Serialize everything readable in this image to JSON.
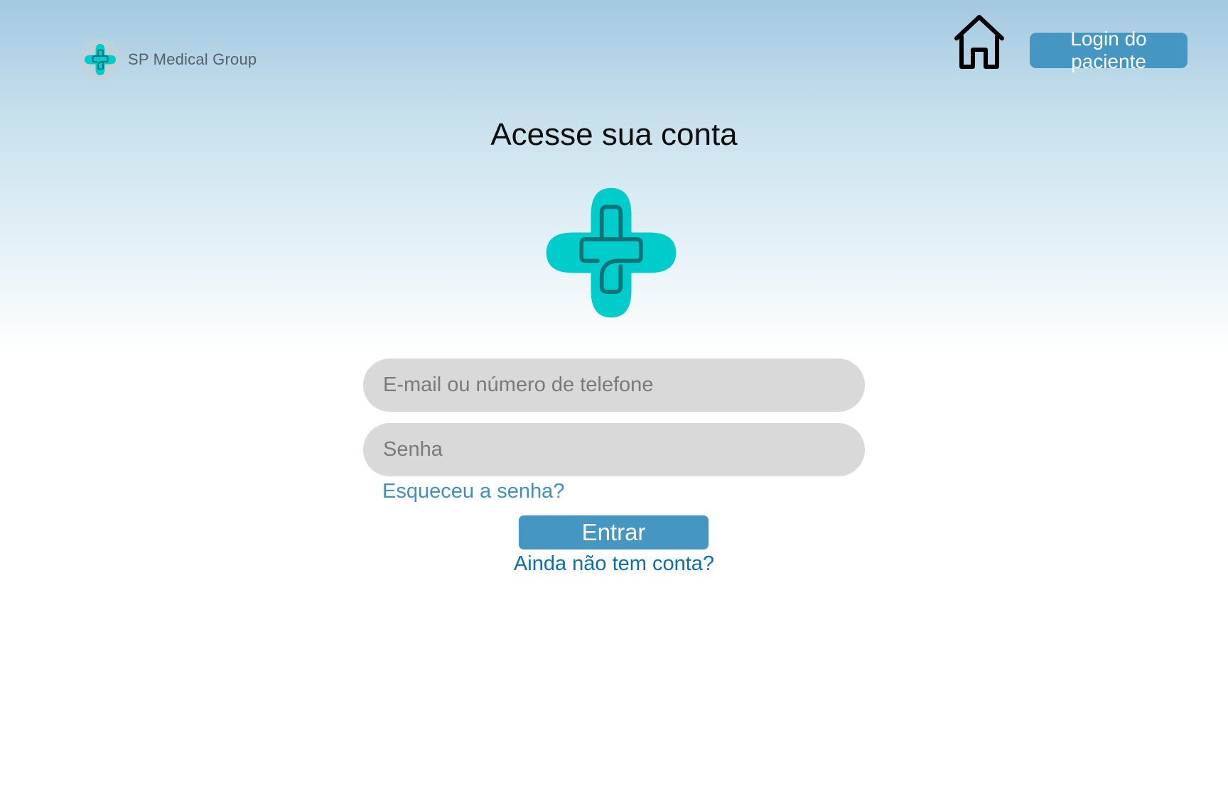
{
  "brand": {
    "name": "SP Medical Group",
    "logo_icon": "medical-cross-icon",
    "logo_color": "#00cccc",
    "logo_stroke_color": "#0f7378"
  },
  "nav": {
    "home_icon": "home-icon",
    "patient_login_label": "Login do paciente"
  },
  "login": {
    "title": "Acesse sua conta",
    "email_placeholder": "E-mail ou número de telefone",
    "email_value": "",
    "password_placeholder": "Senha",
    "password_value": "",
    "forgot_password_label": "Esqueceu a senha?",
    "submit_label": "Entrar",
    "signup_label": "Ainda não tem conta?"
  },
  "colors": {
    "accent": "#4696c4",
    "link": "#3f8fc0",
    "signup_link": "#0c6eaa",
    "field_bg": "#d9d9d9"
  }
}
